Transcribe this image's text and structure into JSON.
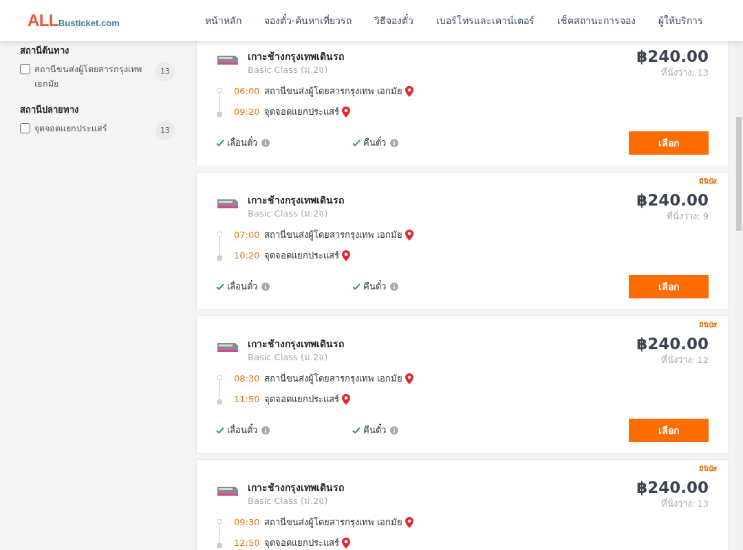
{
  "logo": {
    "main": "ALL",
    "sub": "Busticket.com"
  },
  "nav": [
    "หน้าหลัก",
    "จองตั๋ว-ค้นหาเที่ยวรถ",
    "วิธีจองตั๋ว",
    "เบอร์โทรและเคาน์เตอร์",
    "เช็คสถานะการจอง",
    "ผู้ให้บริการ"
  ],
  "filters": [
    {
      "title": "สถานีต้นทาง",
      "options": [
        {
          "label": "สถานีขนส่งผู้โดยสารกรุงเทพ เอกมัย",
          "count": "13",
          "checked": false
        }
      ]
    },
    {
      "title": "สถานีปลายทาง",
      "options": [
        {
          "label": "จุดจอดแยกประแสร์",
          "count": "13",
          "checked": false
        }
      ]
    }
  ],
  "trips": [
    {
      "operator": "เกาะช้างกรุงเทพเดินรถ",
      "class": "Basic Class (ม.2จ)",
      "price": "฿240.00",
      "seats": "ที่นั่งว่าง: 13",
      "stops": [
        {
          "time": "06:00",
          "place": "สถานีขนส่งผู้โดยสารกรุงเทพ เอกมัย"
        },
        {
          "time": "09:20",
          "place": "จุดจอดแยกประแสร์"
        }
      ],
      "features": [
        {
          "label": "เลื่อนตั๋ว",
          "available": true
        },
        {
          "label": "คืนตั๋ว",
          "available": true
        }
      ],
      "button": "เลือก"
    },
    {
      "tag": "มินิบัส",
      "operator": "เกาะช้างกรุงเทพเดินรถ",
      "class": "Basic Class (ม.2จ)",
      "price": "฿240.00",
      "seats": "ที่นั่งว่าง: 9",
      "stops": [
        {
          "time": "07:00",
          "place": "สถานีขนส่งผู้โดยสารกรุงเทพ เอกมัย"
        },
        {
          "time": "10:20",
          "place": "จุดจอดแยกประแสร์"
        }
      ],
      "features": [
        {
          "label": "เลื่อนตั๋ว",
          "available": true
        },
        {
          "label": "คืนตั๋ว",
          "available": true
        }
      ],
      "button": "เลือก"
    },
    {
      "tag": "มินิบัส",
      "operator": "เกาะช้างกรุงเทพเดินรถ",
      "class": "Basic Class (ม.2จ)",
      "price": "฿240.00",
      "seats": "ที่นั่งว่าง: 12",
      "stops": [
        {
          "time": "08:30",
          "place": "สถานีขนส่งผู้โดยสารกรุงเทพ เอกมัย"
        },
        {
          "time": "11:50",
          "place": "จุดจอดแยกประแสร์"
        }
      ],
      "features": [
        {
          "label": "เลื่อนตั๋ว",
          "available": true
        },
        {
          "label": "คืนตั๋ว",
          "available": true
        }
      ],
      "button": "เลือก"
    },
    {
      "tag": "มินิบัส",
      "operator": "เกาะช้างกรุงเทพเดินรถ",
      "class": "Basic Class (ม.2จ)",
      "price": "฿240.00",
      "seats": "ที่นั่งว่าง: 13",
      "stops": [
        {
          "time": "09:30",
          "place": "สถานีขนส่งผู้โดยสารกรุงเทพ เอกมัย"
        },
        {
          "time": "12:50",
          "place": "จุดจอดแยกประแสร์"
        }
      ]
    }
  ]
}
